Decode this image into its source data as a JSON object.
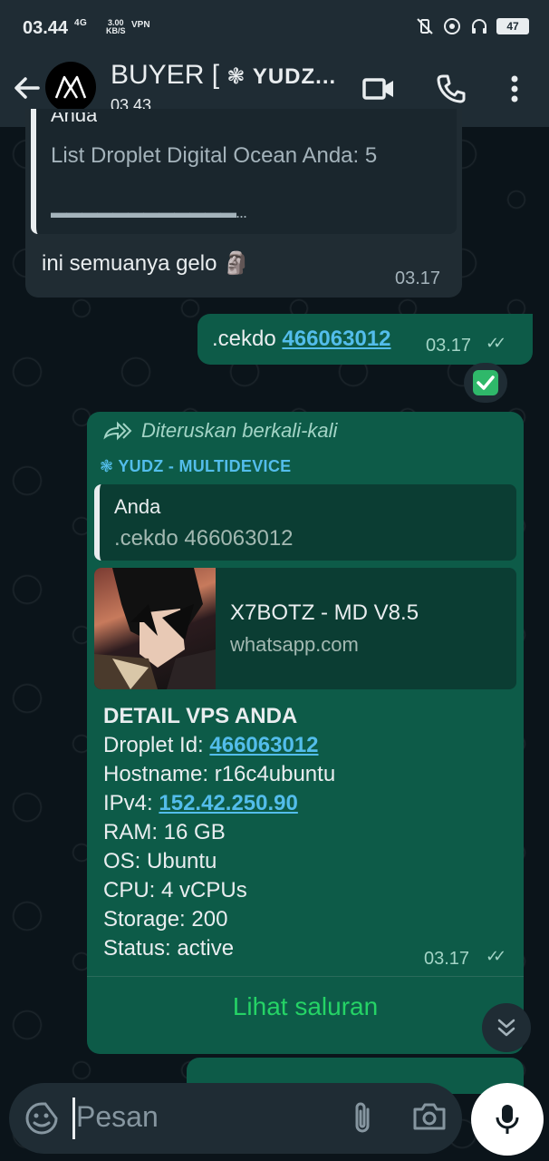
{
  "status_bar": {
    "time": "03.44",
    "network": "4G",
    "speed_value": "3.00",
    "speed_unit": "KB/S",
    "vpn": "VPN",
    "battery": "47"
  },
  "header": {
    "title_prefix": "BUYER [",
    "title_star": "❃",
    "title_name": "YUDZ...",
    "subtitle": "03.43"
  },
  "messages": {
    "m1": {
      "quote_author": "Anda",
      "quote_text": "List Droplet Digital Ocean Anda: 5",
      "quote_divider": "▬▬▬▬▬▬▬▬▬▬▬▬...",
      "text": "ini semuanya gelo 🗿",
      "time": "03.17"
    },
    "m2": {
      "prefix": ".cekdo",
      "link": "466063012",
      "time": "03.17",
      "ticks": "✓✓"
    },
    "m3": {
      "forwarded": "Diteruskan berkali-kali",
      "sender": "❃ YUDZ - MULTIDEVICE",
      "quote_author": "Anda",
      "quote_text": ".cekdo 466063012",
      "preview_title": "X7BOTZ - MD V8.5",
      "preview_domain": "whatsapp.com",
      "heading": "DETAIL VPS ANDA",
      "droplet_label": "Droplet Id:",
      "droplet_value": "466063012",
      "hostname": "Hostname: r16c4ubuntu",
      "ipv4_label": "IPv4:",
      "ipv4_value": "152.42.250.90",
      "ram": "RAM: 16 GB",
      "os": "OS: Ubuntu",
      "cpu": "CPU: 4 vCPUs",
      "storage": "Storage: 200",
      "status": "Status: active",
      "time": "03.17",
      "ticks": "✓✓",
      "action": "Lihat saluran"
    }
  },
  "input": {
    "placeholder": "Pesan"
  },
  "colors": {
    "header_bg": "#1f2c34",
    "incoming_bubble": "#202c33",
    "outgoing_bubble": "#0d5b48",
    "link": "#53bdeb",
    "accent_green": "#25d366"
  }
}
